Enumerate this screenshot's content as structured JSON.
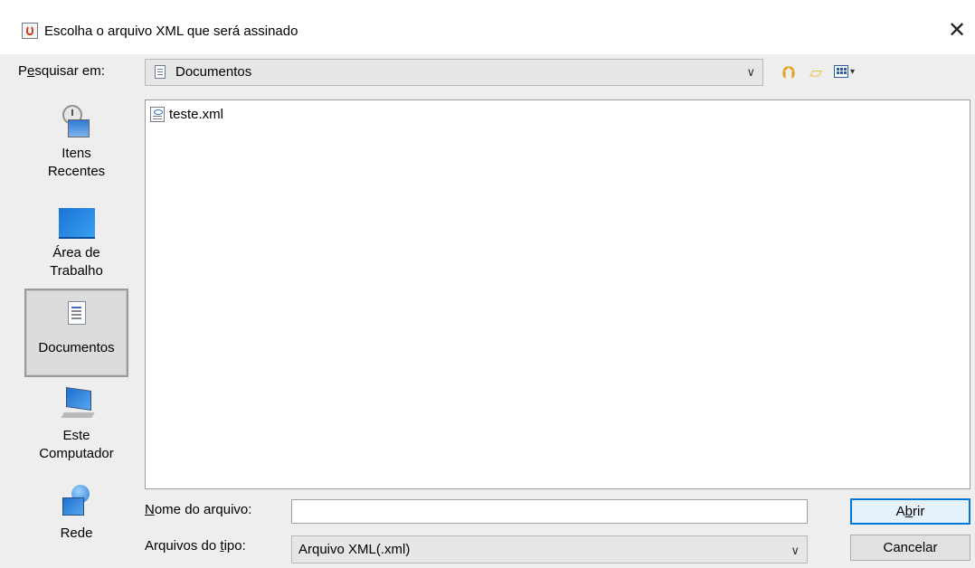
{
  "window": {
    "title": "Escolha o arquivo XML que será assinado",
    "close_glyph": "✕"
  },
  "lookin": {
    "label_pre": "P",
    "label_mnemonic": "e",
    "label_post": "squisar em:",
    "value": "Documentos",
    "arrow": "∨"
  },
  "toolbar": {
    "up_icon": "up-folder-icon",
    "new_folder_icon": "new-folder-icon",
    "view_menu_icon": "view-menu-icon"
  },
  "places": [
    {
      "label_line1": "Itens",
      "label_line2": "Recentes",
      "icon": "recent-items-icon",
      "selected": false
    },
    {
      "label_line1": "Área de",
      "label_line2": "Trabalho",
      "icon": "desktop-icon",
      "selected": false
    },
    {
      "label_line1": "Documentos",
      "label_line2": "",
      "icon": "documents-icon",
      "selected": true
    },
    {
      "label_line1": "Este",
      "label_line2": "Computador",
      "icon": "computer-icon",
      "selected": false
    },
    {
      "label_line1": "Rede",
      "label_line2": "",
      "icon": "network-icon",
      "selected": false
    }
  ],
  "files": [
    {
      "name": "teste.xml",
      "icon": "xml-file-icon"
    }
  ],
  "form": {
    "filename_label_mnemonic": "N",
    "filename_label_rest": "ome do arquivo:",
    "filename_value": "",
    "filetype_label_pre": "Arquivos do ",
    "filetype_label_mnemonic": "t",
    "filetype_label_post": "ipo:",
    "filetype_value": "Arquivo XML(.xml)",
    "filetype_arrow": "∨"
  },
  "buttons": {
    "open_pre": "A",
    "open_mnemonic": "b",
    "open_post": "rir",
    "cancel": "Cancelar"
  }
}
